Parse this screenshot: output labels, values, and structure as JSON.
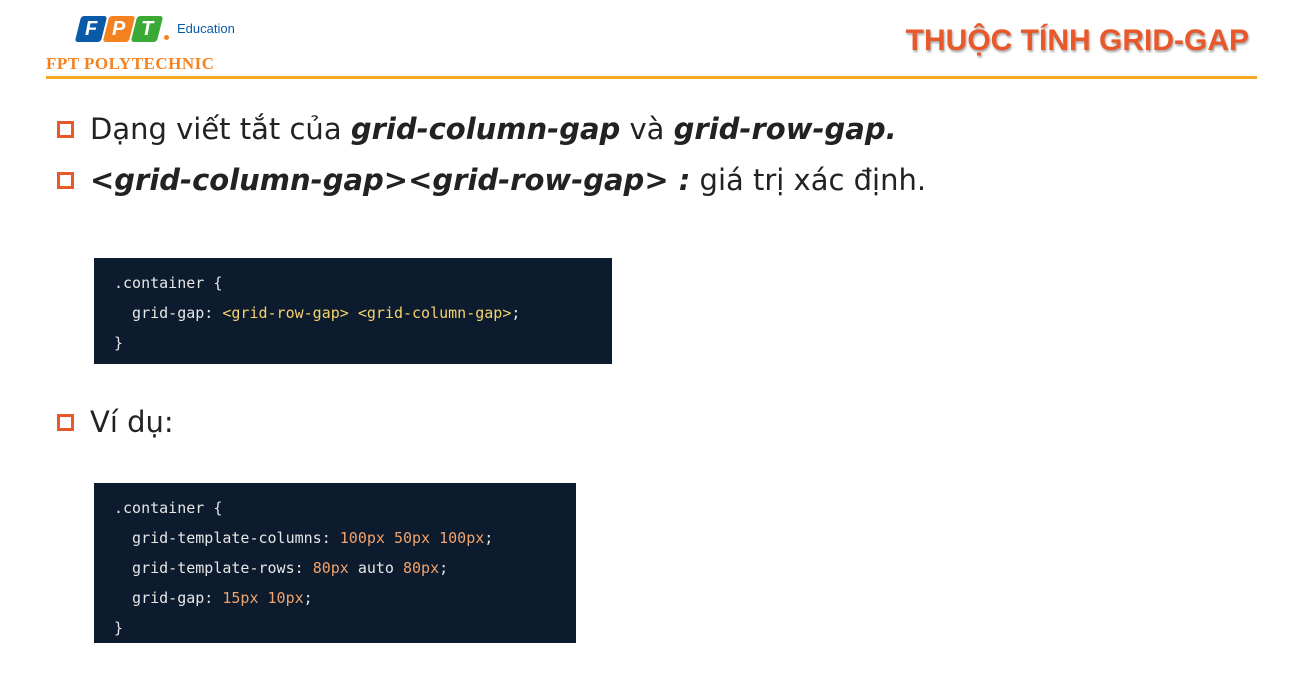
{
  "logo": {
    "letters": [
      "F",
      "P",
      "T"
    ],
    "tile_colors": [
      "#0a5aa8",
      "#f58220",
      "#3aa935"
    ],
    "education": "Education",
    "polytechnic": "FPT POLYTECHNIC"
  },
  "title": "THUỘC TÍNH GRID-GAP",
  "bullets": [
    {
      "pre": "Dạng viết tắt của ",
      "em1": "grid-column-gap",
      "mid": " và ",
      "em2": "grid-row-gap."
    },
    {
      "em": "<grid-column-gap><grid-row-gap> :",
      "post": " giá trị xác định."
    },
    {
      "text": "Ví dụ:"
    }
  ],
  "code1": {
    "l1": ".container {",
    "l2a": "  grid-gap: ",
    "l2b": "<grid-row-gap> <grid-column-gap>",
    "l2c": ";",
    "l3": "}"
  },
  "code2": {
    "l1": ".container {",
    "l2a": "  grid-template-columns: ",
    "l2b": "100px 50px 100px",
    "l2c": ";",
    "l3a": "  grid-template-rows: ",
    "l3b": "80px",
    "l3c": " auto ",
    "l3d": "80px",
    "l3e": ";",
    "l4a": "  grid-gap: ",
    "l4b": "15px 10px",
    "l4c": ";",
    "l5": "}"
  },
  "colors": {
    "accent": "#e8582a",
    "rule": "#f5a623",
    "code_bg": "#0d1b2e"
  }
}
